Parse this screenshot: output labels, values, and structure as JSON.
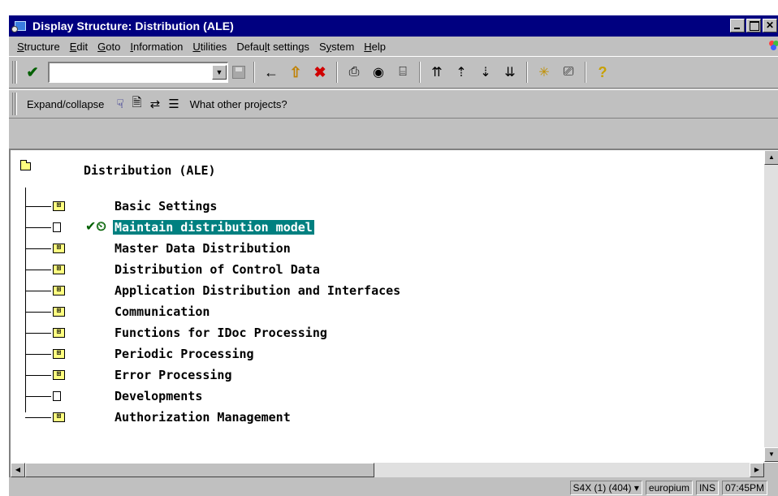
{
  "window": {
    "title": "Display Structure: Distribution (ALE)",
    "min_glyph": "",
    "max_glyph": "",
    "close_glyph": "✕"
  },
  "menu": [
    {
      "pre": "",
      "ul": "S",
      "post": "tructure"
    },
    {
      "pre": "",
      "ul": "E",
      "post": "dit"
    },
    {
      "pre": "",
      "ul": "G",
      "post": "oto"
    },
    {
      "pre": "",
      "ul": "I",
      "post": "nformation"
    },
    {
      "pre": "",
      "ul": "U",
      "post": "tilities"
    },
    {
      "pre": "Defau",
      "ul": "l",
      "post": "t settings"
    },
    {
      "pre": "S",
      "ul": "y",
      "post": "stem"
    },
    {
      "pre": "",
      "ul": "H",
      "post": "elp"
    }
  ],
  "toolbar": {
    "command_value": "",
    "icons": {
      "enter": "✔",
      "back": "🡄",
      "exit": "⇧",
      "cancel": "✖",
      "print": "⎙",
      "find": "⚲",
      "find_next": "⌸",
      "first_page": "⇈",
      "prev_page": "⇡",
      "next_page": "⇣",
      "last_page": "⇊",
      "create_session": "✳",
      "shortcut": "⎚",
      "help": "?"
    },
    "colors": {
      "enter": "#007000",
      "back": "#000000",
      "exit": "#c08000",
      "cancel": "#d00000",
      "help": "#c8a000"
    }
  },
  "app_toolbar": {
    "expand_label": "Expand/collapse",
    "icons": {
      "structure": "⚐",
      "docu": "🗎",
      "change": "⇄",
      "list": "☰"
    },
    "other_projects": "What other projects?"
  },
  "tree": {
    "root": "Distribution (ALE)",
    "nodes": [
      {
        "label": "Basic Settings",
        "type": "folder",
        "selected": false,
        "has_check": false
      },
      {
        "label": "Maintain distribution model",
        "type": "doc",
        "selected": true,
        "has_check": true
      },
      {
        "label": "Master Data Distribution",
        "type": "folder",
        "selected": false,
        "has_check": false
      },
      {
        "label": "Distribution of Control Data",
        "type": "folder",
        "selected": false,
        "has_check": false
      },
      {
        "label": "Application Distribution and Interfaces",
        "type": "folder",
        "selected": false,
        "has_check": false
      },
      {
        "label": "Communication",
        "type": "folder",
        "selected": false,
        "has_check": false
      },
      {
        "label": "Functions for IDoc Processing",
        "type": "folder",
        "selected": false,
        "has_check": false
      },
      {
        "label": "Periodic Processing",
        "type": "folder",
        "selected": false,
        "has_check": false
      },
      {
        "label": "Error Processing",
        "type": "folder",
        "selected": false,
        "has_check": false
      },
      {
        "label": "Developments",
        "type": "doc",
        "selected": false,
        "has_check": false
      },
      {
        "label": "Authorization Management",
        "type": "folder",
        "selected": false,
        "has_check": false
      }
    ],
    "folder_glyph": "⊞",
    "check_glyph": "✔⏲"
  },
  "status": {
    "system": "S4X (1) (404)",
    "dropdown": "▾",
    "server": "europium",
    "mode": "INS",
    "time": "07:45PM"
  }
}
